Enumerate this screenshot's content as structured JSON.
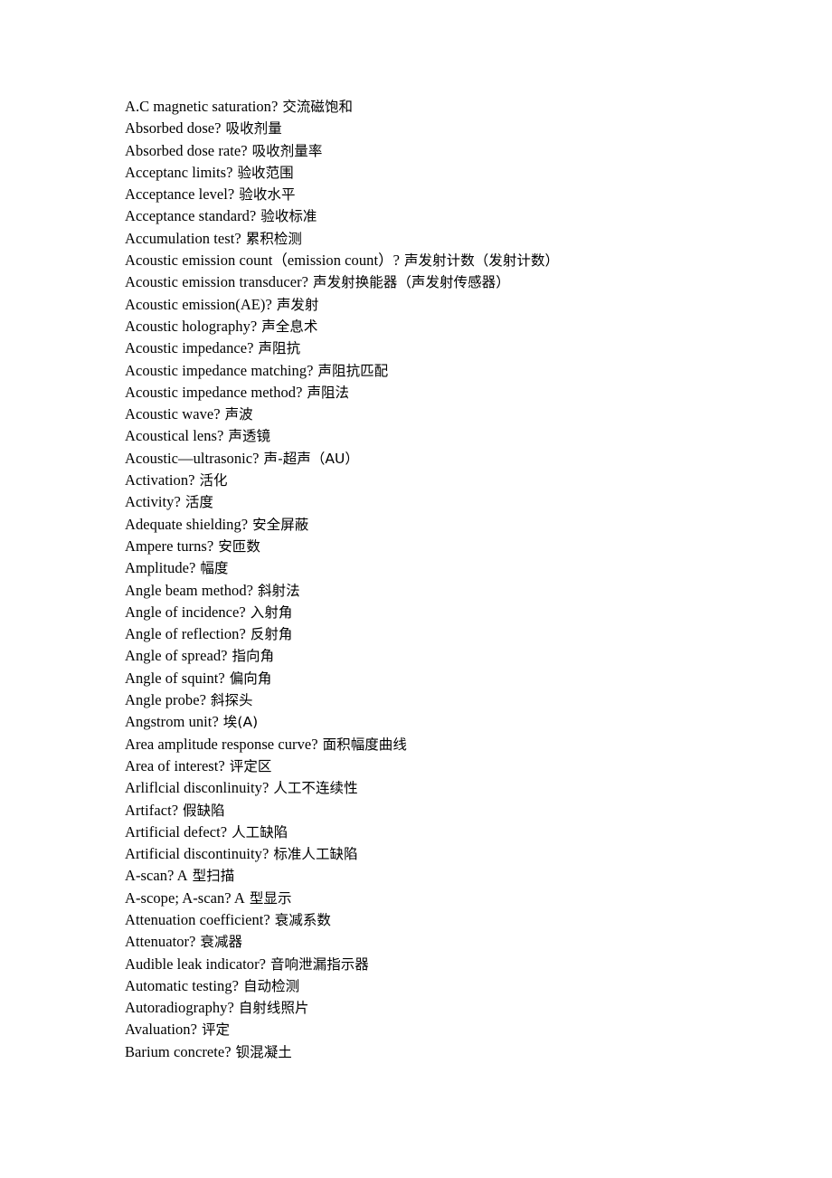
{
  "document": {
    "type": "glossary",
    "page_background": "#ffffff",
    "text_color": "#000000",
    "entries": [
      {
        "term": "A.C magnetic saturation?",
        "gloss": " 交流磁饱和"
      },
      {
        "term": "Absorbed dose?",
        "gloss": " 吸收剂量"
      },
      {
        "term": "Absorbed dose rate?",
        "gloss": " 吸收剂量率"
      },
      {
        "term": "Acceptanc limits?",
        "gloss": " 验收范围"
      },
      {
        "term": "Acceptance level?",
        "gloss": " 验收水平"
      },
      {
        "term": "Acceptance standard?",
        "gloss": " 验收标准"
      },
      {
        "term": "Accumulation test?",
        "gloss": " 累积检测"
      },
      {
        "term": "Acoustic emission count（emission count）?",
        "gloss": " 声发射计数（发射计数）"
      },
      {
        "term": "Acoustic emission transducer?",
        "gloss": " 声发射换能器（声发射传感器）"
      },
      {
        "term": "Acoustic emission(AE)?",
        "gloss": " 声发射"
      },
      {
        "term": "Acoustic holography?",
        "gloss": " 声全息术"
      },
      {
        "term": "Acoustic impedance?",
        "gloss": " 声阻抗"
      },
      {
        "term": "Acoustic impedance matching?",
        "gloss": " 声阻抗匹配"
      },
      {
        "term": "Acoustic impedance method?",
        "gloss": " 声阻法"
      },
      {
        "term": "Acoustic wave?",
        "gloss": " 声波"
      },
      {
        "term": "Acoustical lens?",
        "gloss": " 声透镜"
      },
      {
        "term": "Acoustic—ultrasonic?",
        "gloss": " 声-超声（AU）"
      },
      {
        "term": "Activation?",
        "gloss": " 活化"
      },
      {
        "term": "Activity?",
        "gloss": " 活度"
      },
      {
        "term": "Adequate shielding?",
        "gloss": " 安全屏蔽"
      },
      {
        "term": "Ampere turns?",
        "gloss": " 安匝数"
      },
      {
        "term": "Amplitude?",
        "gloss": " 幅度"
      },
      {
        "term": "Angle beam method?",
        "gloss": " 斜射法"
      },
      {
        "term": "Angle of incidence?",
        "gloss": " 入射角"
      },
      {
        "term": "Angle of reflection?",
        "gloss": " 反射角"
      },
      {
        "term": "Angle of spread?",
        "gloss": " 指向角"
      },
      {
        "term": "Angle of squint?",
        "gloss": " 偏向角"
      },
      {
        "term": "Angle probe?",
        "gloss": " 斜探头"
      },
      {
        "term": "Angstrom unit?",
        "gloss": " 埃(A)"
      },
      {
        "term": "Area amplitude response curve?",
        "gloss": " 面积幅度曲线"
      },
      {
        "term": "Area of interest?",
        "gloss": " 评定区"
      },
      {
        "term": "Arliflcial disconlinuity?",
        "gloss": " 人工不连续性"
      },
      {
        "term": "Artifact?",
        "gloss": " 假缺陷"
      },
      {
        "term": "Artificial defect?",
        "gloss": " 人工缺陷"
      },
      {
        "term": "Artificial discontinuity?",
        "gloss": " 标准人工缺陷"
      },
      {
        "term": "A-scan? A",
        "gloss": " 型扫描"
      },
      {
        "term": "A-scope; A-scan? A",
        "gloss": " 型显示"
      },
      {
        "term": "Attenuation coefficient?",
        "gloss": " 衰减系数"
      },
      {
        "term": "Attenuator?",
        "gloss": " 衰减器"
      },
      {
        "term": "Audible leak indicator?",
        "gloss": " 音响泄漏指示器"
      },
      {
        "term": "Automatic testing?",
        "gloss": " 自动检测"
      },
      {
        "term": "Autoradiography?",
        "gloss": " 自射线照片"
      },
      {
        "term": "Avaluation?",
        "gloss": " 评定"
      },
      {
        "term": "Barium concrete?",
        "gloss": " 钡混凝土"
      }
    ]
  }
}
